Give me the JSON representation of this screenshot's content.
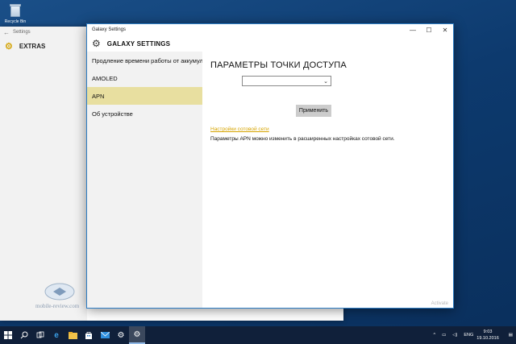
{
  "desktop": {
    "recycle_bin_label": "Recycle Bin",
    "watermark_text": "mobile-review.com"
  },
  "background_window": {
    "title": "Settings",
    "nav_label": "EXTRAS",
    "icon": "gear-icon"
  },
  "window": {
    "title": "Galaxy Settings",
    "controls": {
      "minimize": "—",
      "maximize": "☐",
      "close": "✕"
    }
  },
  "app_header": {
    "label": "GALAXY SETTINGS",
    "icon": "gear-icon"
  },
  "sidebar": {
    "items": [
      {
        "label": "Продление времени работы от аккумул"
      },
      {
        "label": "AMOLED"
      },
      {
        "label": "APN",
        "active": true
      },
      {
        "label": "Об устройстве"
      }
    ],
    "active_color": "#e8dfa0"
  },
  "content": {
    "heading": "ПАРАМЕТРЫ ТОЧКИ ДОСТУПА",
    "dropdown_value": "",
    "apply_label": "Применить",
    "link_text": "Настройки сотовой сети",
    "description": "Параметры APN можно изменить в расширенных настройках сотовой сети.",
    "activate_text": "Activate",
    "link_color": "#d6a400"
  },
  "taskbar": {
    "icons": [
      "windows-start-icon",
      "search-icon",
      "task-view-icon",
      "edge-icon",
      "file-explorer-icon",
      "store-icon",
      "mail-icon",
      "settings-icon",
      "galaxy-settings-icon"
    ],
    "tray_language": "ENG",
    "time": "9:03",
    "date": "19.10.2016"
  }
}
